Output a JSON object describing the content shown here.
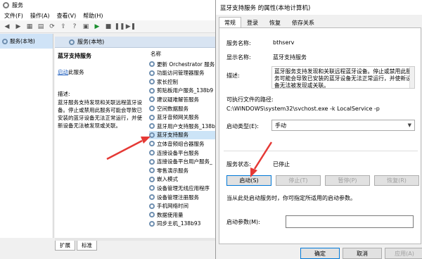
{
  "services_window": {
    "title": "服务",
    "menu": [
      "文件(F)",
      "操作(A)",
      "查看(V)",
      "帮助(H)"
    ],
    "tree_item": "服务(本地)",
    "header_title": "服务(本地)",
    "description_pane": {
      "service_title": "蓝牙支持服务",
      "start_link": "启动",
      "start_suffix": "此服务",
      "desc_label": "描述:",
      "desc_text": "蓝牙服务支持发现和关联远程蓝牙设备。停止或禁用此服务可能会导致已安装的蓝牙设备无法正常运行，并使新设备无法被发现或关联。"
    },
    "list_column": "名称",
    "services": [
      "更新 Orchestrator 服务",
      "功能访问管理器服务",
      "家长控制",
      "剪贴板用户服务_138b9",
      "建议疑难解答服务",
      "空间数据服务",
      "蓝牙音频网关服务",
      "蓝牙用户支持服务_138b",
      "蓝牙支持服务",
      "立体音频组合器服务",
      "连接设备平台服务",
      "连接设备平台用户服务_",
      "零售演示服务",
      "嵌入模式",
      "设备管理无线应用程序",
      "设备管理注册服务",
      "手机网络时间",
      "数据使用量",
      "同步主机_138b93"
    ],
    "selected_index": 8,
    "bottom_tabs": [
      "扩展",
      "标准"
    ]
  },
  "dialog": {
    "title": "蓝牙支持服务 的属性(本地计算机)",
    "tabs": [
      "常规",
      "登录",
      "恢复",
      "依存关系"
    ],
    "service_name_label": "服务名称:",
    "service_name": "bthserv",
    "display_name_label": "显示名称:",
    "display_name": "蓝牙支持服务",
    "description_label": "描述:",
    "description": "蓝牙服务支持发现和关联远程蓝牙设备。停止或禁用此服务可能会导致已安装的蓝牙设备无法正常运行，并使新设备无法被发现或关联。",
    "exe_path_label": "可执行文件的路径:",
    "exe_path": "C:\\WINDOWS\\system32\\svchost.exe -k LocalService -p",
    "startup_type_label": "启动类型(E):",
    "startup_type": "手动",
    "status_label": "服务状态:",
    "status": "已停止",
    "buttons": {
      "start": "启动(S)",
      "stop": "停止(T)",
      "pause": "暂停(P)",
      "resume": "恢复(R)"
    },
    "hint": "当从此处启动服务时，你可指定所适用的启动参数。",
    "params_label": "启动参数(M):",
    "params_value": "",
    "footer": {
      "ok": "确定",
      "cancel": "取消",
      "apply": "应用(A)"
    }
  },
  "colors": {
    "annotation_arrow": "#e53935",
    "selection": "#cce4f7",
    "link": "#1f5fbf"
  }
}
